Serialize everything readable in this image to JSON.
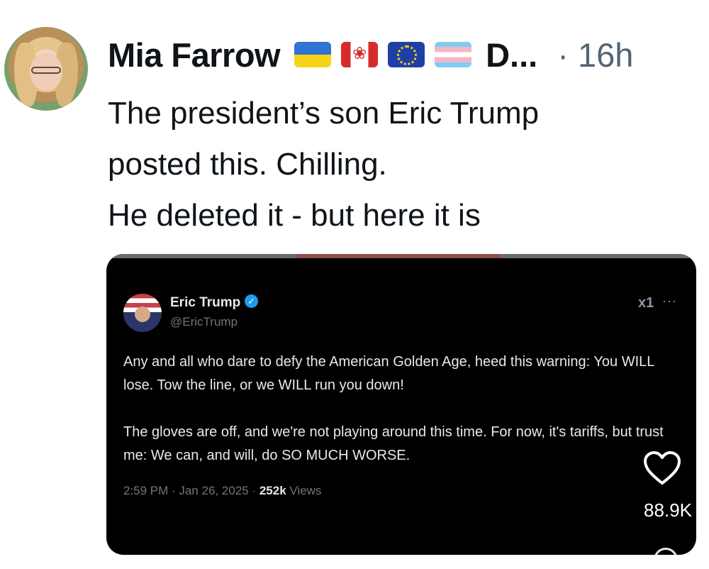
{
  "post": {
    "author_name": "Mia Farrow",
    "author_truncated": "D...",
    "time": "· 16h",
    "flags": [
      "flag-ukraine-icon",
      "flag-canada-icon",
      "flag-eu-icon",
      "flag-transgender-icon"
    ],
    "text_lines": [
      "The president’s son Eric Trump",
      "posted this. Chilling.",
      "He deleted it - but here it is"
    ]
  },
  "embed": {
    "name": "Eric Trump",
    "handle": "@EricTrump",
    "grok_label": "x1",
    "more_label": "···",
    "paragraphs": [
      "Any and all who dare to defy the American Golden Age, heed this warning: You WILL lose. Tow the line, or we WILL run you down!",
      "The gloves are off, and we're not playing around this time. For now, it's tariffs, but trust me: We can, and will, do SO MUCH WORSE."
    ],
    "timestamp": "2:59 PM · Jan 26, 2025 · ",
    "views_count": "252k",
    "views_label": " Views",
    "likes": "88.9K"
  },
  "colors": {
    "secondary_text": "#536471",
    "embed_background": "#000000",
    "verified_blue": "#1d9bf0"
  }
}
